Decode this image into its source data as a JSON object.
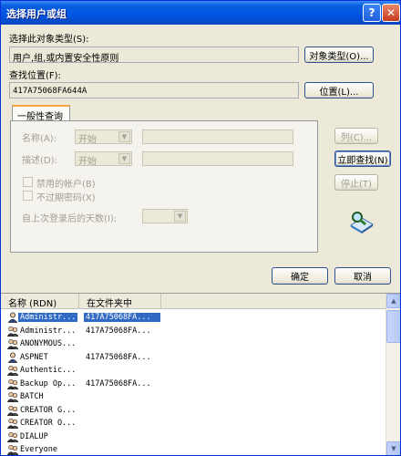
{
  "window": {
    "title": "选择用户或组",
    "help_glyph": "?",
    "close_glyph": "✕"
  },
  "object_type": {
    "label": "选择此对象类型(S):",
    "value": "用户,组,或内置安全性原则",
    "button": "对象类型(O)..."
  },
  "location": {
    "label": "查找位置(F):",
    "value": "417A75068FA644A",
    "button": "位置(L)..."
  },
  "query": {
    "tab_label": "一般性查询",
    "name_label": "名称(A):",
    "name_mode": "开始",
    "desc_label": "描述(D):",
    "desc_mode": "开始",
    "disabled_accounts": "禁用的帐户(B)",
    "no_expire_password": "不过期密码(X)",
    "days_since_logon": "自上次登录后的天数(I):"
  },
  "side_buttons": {
    "columns": "列(C)...",
    "find_now": "立即查找(N)",
    "stop": "停止(T)"
  },
  "footer": {
    "ok": "确定",
    "cancel": "取消"
  },
  "results": {
    "col_name": "名称 (RDN)",
    "col_folder": "在文件夹中",
    "rows": [
      {
        "name": "Administr...",
        "folder": "417A75068FA...",
        "icon": "user-icon"
      },
      {
        "name": "Administr...",
        "folder": "417A75068FA...",
        "icon": "group-icon"
      },
      {
        "name": "ANONYMOUS...",
        "folder": "",
        "icon": "group-icon"
      },
      {
        "name": "ASPNET",
        "folder": "417A75068FA...",
        "icon": "user-icon"
      },
      {
        "name": "Authentic...",
        "folder": "",
        "icon": "group-icon"
      },
      {
        "name": "Backup Op...",
        "folder": "417A75068FA...",
        "icon": "group-icon"
      },
      {
        "name": "BATCH",
        "folder": "",
        "icon": "group-icon"
      },
      {
        "name": "CREATOR G...",
        "folder": "",
        "icon": "group-icon"
      },
      {
        "name": "CREATOR O...",
        "folder": "",
        "icon": "group-icon"
      },
      {
        "name": "DIALUP",
        "folder": "",
        "icon": "group-icon"
      },
      {
        "name": "Everyone",
        "folder": "",
        "icon": "group-icon"
      }
    ]
  }
}
